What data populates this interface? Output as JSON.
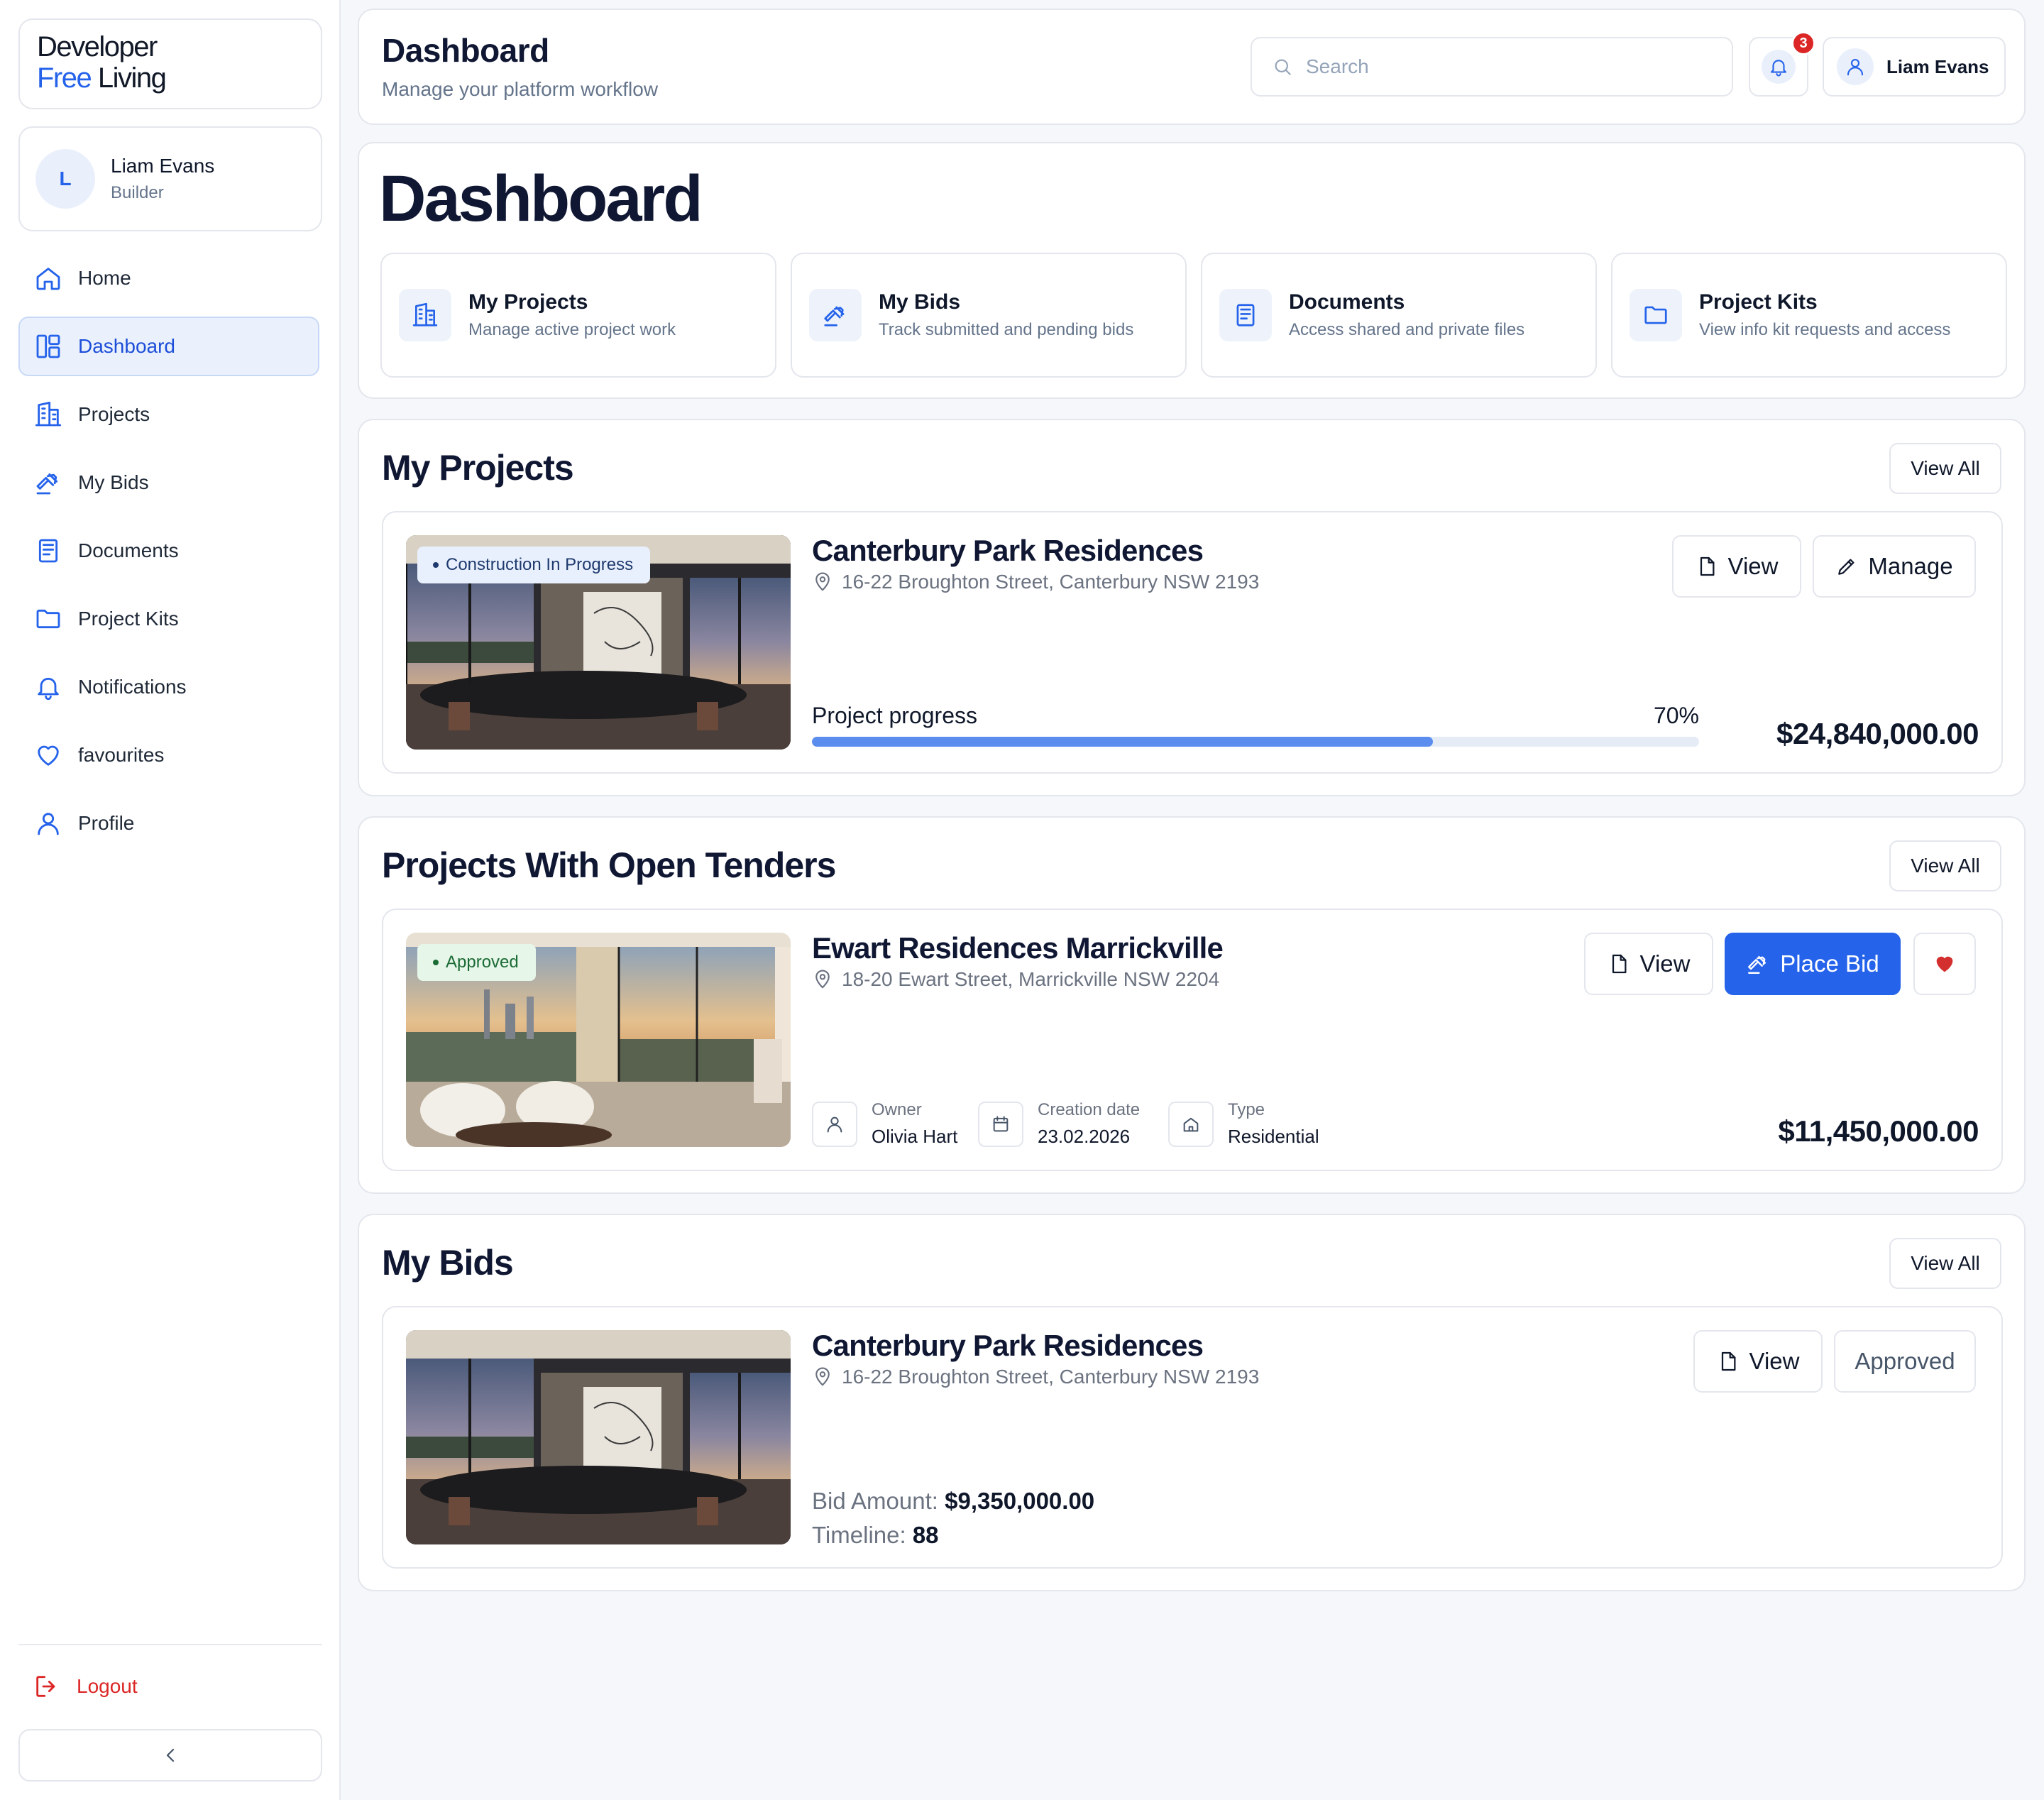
{
  "brand": {
    "line1": "Developer",
    "line2_accent": "Free",
    "line2_rest": " Living"
  },
  "sidebar": {
    "user": {
      "initial": "L",
      "name": "Liam Evans",
      "role": "Builder"
    },
    "items": [
      {
        "label": "Home",
        "icon": "home-icon"
      },
      {
        "label": "Dashboard",
        "icon": "dashboard-icon",
        "active": true
      },
      {
        "label": "Projects",
        "icon": "building-icon"
      },
      {
        "label": "My Bids",
        "icon": "gavel-icon"
      },
      {
        "label": "Documents",
        "icon": "document-icon"
      },
      {
        "label": "Project Kits",
        "icon": "folder-icon"
      },
      {
        "label": "Notifications",
        "icon": "bell-icon"
      },
      {
        "label": "favourites",
        "icon": "heart-icon"
      },
      {
        "label": "Profile",
        "icon": "user-icon"
      }
    ],
    "logout_label": "Logout"
  },
  "header": {
    "title": "Dashboard",
    "subtitle": "Manage your platform workflow",
    "search_placeholder": "Search",
    "notification_count": "3",
    "user_name": "Liam Evans"
  },
  "overview": {
    "title": "Dashboard",
    "quick_links": [
      {
        "title": "My Projects",
        "subtitle": "Manage active project work",
        "icon": "building-icon"
      },
      {
        "title": "My Bids",
        "subtitle": "Track submitted and pending bids",
        "icon": "gavel-icon"
      },
      {
        "title": "Documents",
        "subtitle": "Access shared and private files",
        "icon": "document-icon"
      },
      {
        "title": "Project Kits",
        "subtitle": "View info kit requests and access",
        "icon": "folder-icon"
      }
    ]
  },
  "my_projects": {
    "title": "My Projects",
    "view_all": "View All",
    "project": {
      "status": "Construction In Progress",
      "name": "Canterbury Park Residences",
      "address": "16-22 Broughton Street, Canterbury NSW 2193",
      "view_label": "View",
      "manage_label": "Manage",
      "progress_label": "Project progress",
      "progress_percent": "70%",
      "progress_value": 0.7,
      "price": "$24,840,000.00"
    }
  },
  "open_tenders": {
    "title": "Projects With Open Tenders",
    "view_all": "View All",
    "project": {
      "status": "Approved",
      "name": "Ewart Residences Marrickville",
      "address": "18-20 Ewart Street, Marrickville NSW 2204",
      "view_label": "View",
      "bid_label": "Place Bid",
      "owner_label": "Owner",
      "owner": "Olivia Hart",
      "date_label": "Creation date",
      "date": "23.02.2026",
      "type_label": "Type",
      "type": "Residential",
      "price": "$11,450,000.00"
    }
  },
  "my_bids": {
    "title": "My Bids",
    "view_all": "View All",
    "bid": {
      "name": "Canterbury Park Residences",
      "address": "16-22 Broughton Street, Canterbury NSW 2193",
      "view_label": "View",
      "status_label": "Approved",
      "amount_label": "Bid Amount:",
      "amount": "$9,350,000.00",
      "timeline_label": "Timeline:",
      "timeline": "88"
    }
  },
  "colors": {
    "accent": "#2563eb",
    "danger": "#dc2626",
    "heart": "#d32f2f",
    "progress": "#5b8def"
  }
}
